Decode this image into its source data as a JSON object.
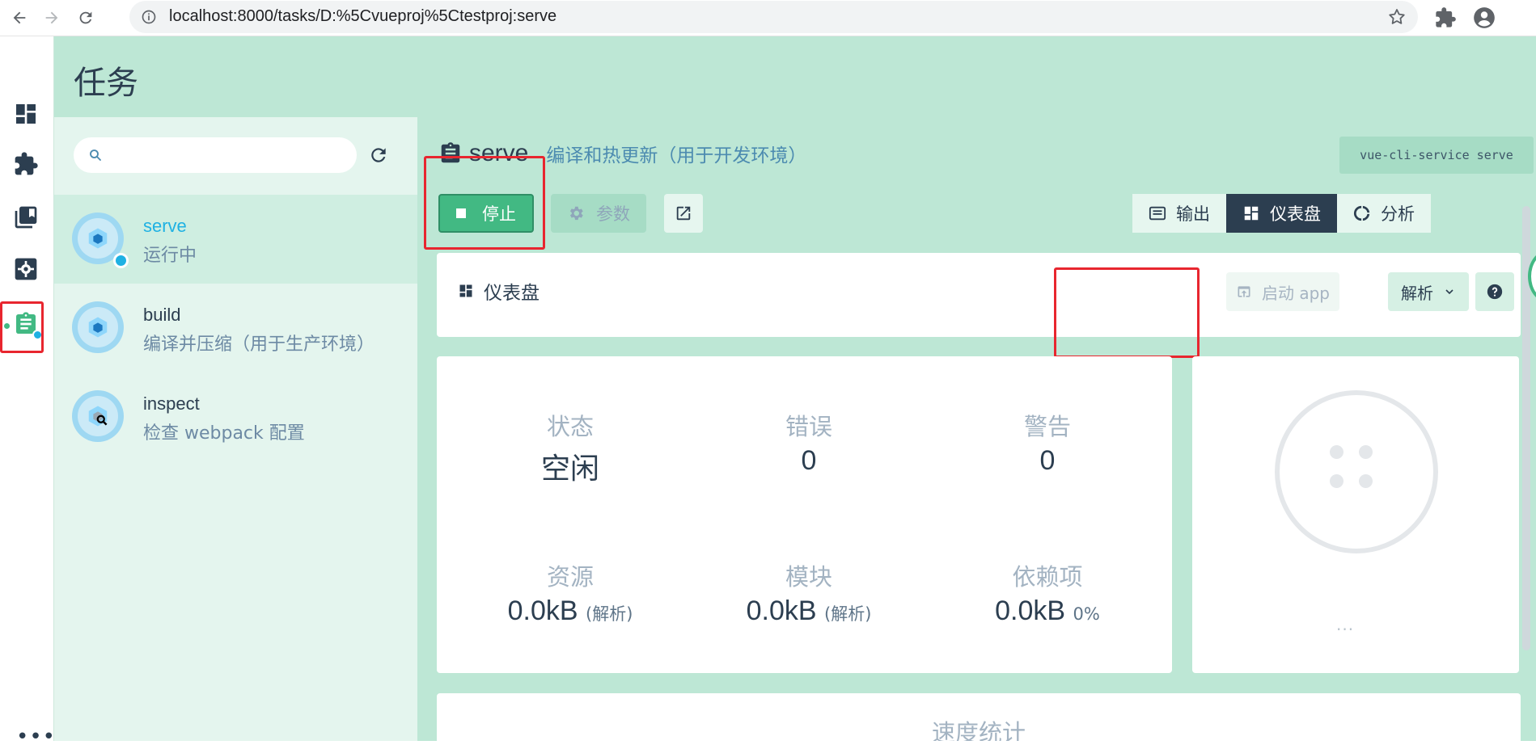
{
  "browser": {
    "url": "localhost:8000/tasks/D:%5Cvueproj%5Ctestproj:serve"
  },
  "page": {
    "title": "任务"
  },
  "task_list": {
    "items": [
      {
        "name": "serve",
        "desc": "运行中",
        "status": "running",
        "icon": "webpack-cube-icon"
      },
      {
        "name": "build",
        "desc": "编译并压缩（用于生产环境）",
        "icon": "webpack-cube-icon"
      },
      {
        "name": "inspect",
        "desc": "检查 webpack 配置",
        "icon": "webpack-inspect-icon"
      }
    ]
  },
  "task": {
    "name": "serve",
    "description": "编译和热更新（用于开发环境）",
    "command": "vue-cli-service serve",
    "stop_label": "停止",
    "params_label": "参数"
  },
  "tabs": [
    {
      "label": "输出",
      "icon": "terminal-icon",
      "active": false
    },
    {
      "label": "仪表盘",
      "icon": "dashboard-icon",
      "active": true
    },
    {
      "label": "分析",
      "icon": "donut-icon",
      "active": false
    }
  ],
  "dashboard": {
    "label": "仪表盘",
    "start_app_label": "启动 app",
    "analyze_label": "解析",
    "stats": {
      "status": {
        "label": "状态",
        "value": "空闲"
      },
      "errors": {
        "label": "错误",
        "value": "0"
      },
      "warnings": {
        "label": "警告",
        "value": "0"
      },
      "assets": {
        "label": "资源",
        "value": "0.0kB",
        "note": "(解析)"
      },
      "modules": {
        "label": "模块",
        "value": "0.0kB",
        "note": "(解析)"
      },
      "deps": {
        "label": "依赖项",
        "value": "0.0kB",
        "note": "0%"
      }
    },
    "progress_more": "...",
    "bottom_title": "速度统计"
  },
  "colors": {
    "accent": "#42b983",
    "header_bg": "#bde7d5",
    "list_bg": "#e4f5ee",
    "dark": "#2c3e50",
    "highlight": "#e8262f"
  }
}
